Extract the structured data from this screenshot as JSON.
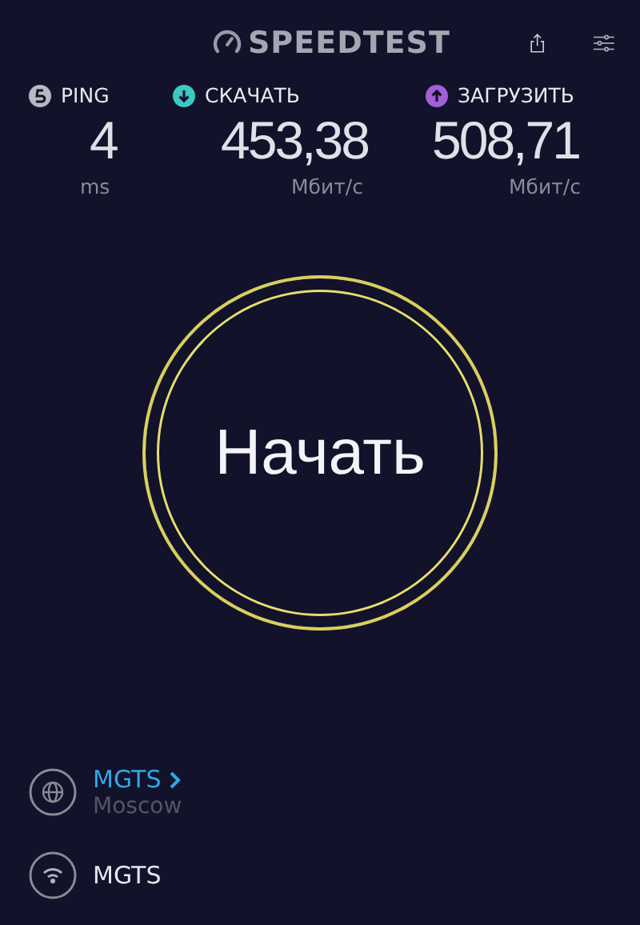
{
  "header": {
    "title": "SPEEDTEST"
  },
  "metrics": [
    {
      "kind": "ping",
      "label": "PING",
      "value": "4",
      "unit": "ms",
      "color": "#b8b8c4"
    },
    {
      "kind": "download",
      "label": "СКАЧАТЬ",
      "value": "453,38",
      "unit": "Мбит/с",
      "color": "#3cc8c0"
    },
    {
      "kind": "upload",
      "label": "ЗАГРУЗИТЬ",
      "value": "508,71",
      "unit": "Мбит/с",
      "color": "#a25fd6"
    }
  ],
  "start_button": {
    "label": "Начать"
  },
  "connections": [
    {
      "kind": "server",
      "name": "MGTS",
      "location": "Moscow",
      "link": true
    },
    {
      "kind": "wifi",
      "name": "MGTS",
      "link": false
    }
  ]
}
